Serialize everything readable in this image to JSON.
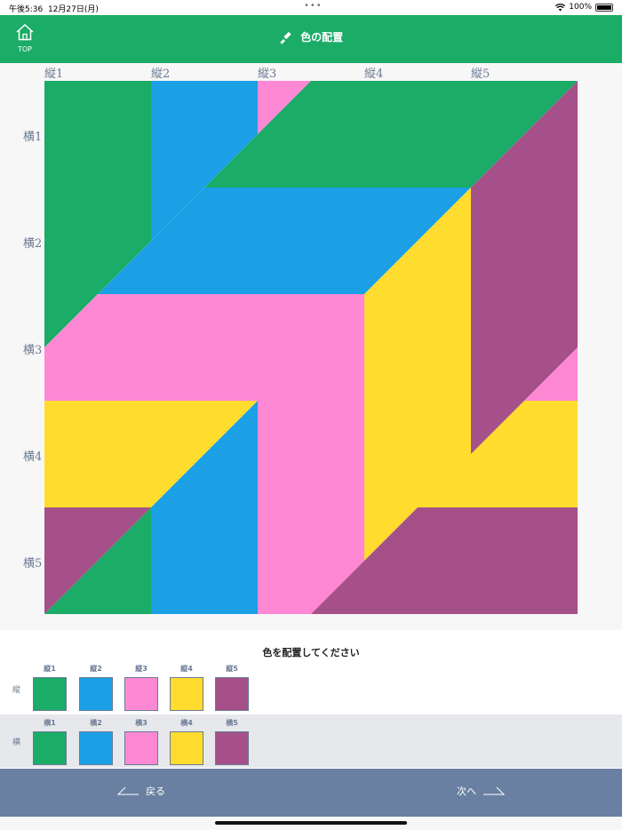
{
  "status": {
    "time": "午後5:36",
    "date": "12月27日(月)",
    "battery": "100%"
  },
  "header": {
    "top_label": "TOP",
    "title": "色の配置"
  },
  "board": {
    "col_labels": [
      "縦1",
      "縦2",
      "縦3",
      "縦4",
      "縦5"
    ],
    "row_labels": [
      "横1",
      "横2",
      "横3",
      "横4",
      "横5"
    ]
  },
  "colors": {
    "green": "#1bac67",
    "blue": "#1ba0e6",
    "pink": "#ff88d5",
    "yellow": "#ffdc2e",
    "purple": "#a6508a",
    "accent": "#6a80a2"
  },
  "panel": {
    "prompt": "色を配置してください",
    "tate": {
      "label": "縦",
      "items": [
        {
          "label": "縦1",
          "color": "#1bac67"
        },
        {
          "label": "縦2",
          "color": "#1ba0e6"
        },
        {
          "label": "縦3",
          "color": "#ff88d5"
        },
        {
          "label": "縦4",
          "color": "#ffdc2e"
        },
        {
          "label": "縦5",
          "color": "#a6508a"
        }
      ]
    },
    "yoko": {
      "label": "横",
      "items": [
        {
          "label": "横1",
          "color": "#1bac67"
        },
        {
          "label": "横2",
          "color": "#1ba0e6"
        },
        {
          "label": "横3",
          "color": "#ff88d5"
        },
        {
          "label": "横4",
          "color": "#ffdc2e"
        },
        {
          "label": "横5",
          "color": "#a6508a"
        }
      ]
    }
  },
  "footer": {
    "back": "戻る",
    "next": "次へ"
  }
}
